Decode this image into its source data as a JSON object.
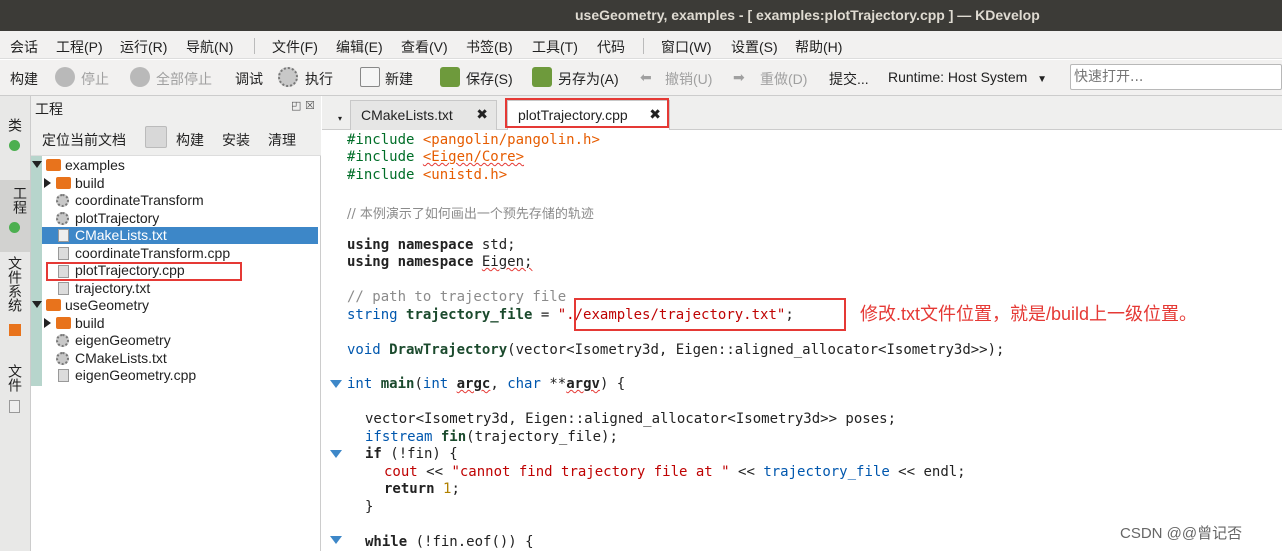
{
  "window": {
    "title": "useGeometry, examples - [ examples:plotTrajectory.cpp ] — KDevelop"
  },
  "menu": [
    "会话",
    "工程(P)",
    "运行(R)",
    "导航(N)",
    "文件(F)",
    "编辑(E)",
    "查看(V)",
    "书签(B)",
    "工具(T)",
    "代码",
    "窗口(W)",
    "设置(S)",
    "帮助(H)"
  ],
  "toolbar": {
    "build": "构建",
    "stop": "停止",
    "stop_all": "全部停止",
    "debug": "调试",
    "execute": "执行",
    "new": "新建",
    "save": "保存(S)",
    "save_as": "另存为(A)",
    "undo": "撤销(U)",
    "redo": "重做(D)",
    "commit": "提交...",
    "runtime": "Runtime: Host System",
    "quick_open_placeholder": "快速打开..."
  },
  "side_tabs": [
    "类",
    "工程",
    "文件系统",
    "文件"
  ],
  "project_panel": {
    "title": "工程",
    "actions": [
      "定位当前文档",
      "构建",
      "安装",
      "清理"
    ]
  },
  "tree": [
    {
      "label": "examples",
      "type": "folder",
      "level": 0,
      "expanded": true
    },
    {
      "label": "build",
      "type": "folder",
      "level": 1,
      "expanded": false
    },
    {
      "label": "coordinateTransform",
      "type": "target",
      "level": 1
    },
    {
      "label": "plotTrajectory",
      "type": "target",
      "level": 1
    },
    {
      "label": "CMakeLists.txt",
      "type": "file",
      "level": 1,
      "selected": true
    },
    {
      "label": "coordinateTransform.cpp",
      "type": "file",
      "level": 1
    },
    {
      "label": "plotTrajectory.cpp",
      "type": "file",
      "level": 1,
      "highlighted": true
    },
    {
      "label": "trajectory.txt",
      "type": "file",
      "level": 1
    },
    {
      "label": "useGeometry",
      "type": "folder",
      "level": 0,
      "expanded": true
    },
    {
      "label": "build",
      "type": "folder",
      "level": 1,
      "expanded": false
    },
    {
      "label": "eigenGeometry",
      "type": "target",
      "level": 1
    },
    {
      "label": "CMakeLists.txt",
      "type": "file",
      "level": 1
    },
    {
      "label": "eigenGeometry.cpp",
      "type": "file",
      "level": 1
    }
  ],
  "editor_tabs": [
    {
      "label": "CMakeLists.txt",
      "active": false
    },
    {
      "label": "plotTrajectory.cpp",
      "active": true
    }
  ],
  "code": {
    "inc1_kw": "#include",
    "inc1_path": "<pangolin/pangolin.h>",
    "inc2_kw": "#include",
    "inc2_path": "<Eigen/Core>",
    "inc3_kw": "#include",
    "inc3_path": "<unistd.h>",
    "comment1": "// 本例演示了如何画出一个预先存储的轨迹",
    "using1": "using namespace",
    "using1_ns": "std;",
    "using2": "using namespace",
    "using2_ns": "Eigen;",
    "comment2": "// path to trajectory file",
    "decl_type": "string",
    "decl_name": "trajectory_file",
    "decl_eq": " = ",
    "decl_val": "\"./examples/trajectory.txt\"",
    "decl_end": ";",
    "func_ret": "void",
    "func_name": "DrawTrajectory",
    "func_params": "(vector<Isometry3d, Eigen::aligned_allocator<Isometry3d>>);",
    "main_ret": "int",
    "main_name": "main",
    "main_params_a": "(",
    "main_int": "int",
    "main_argc": "argc",
    "main_comma": ", ",
    "main_char": "char",
    "main_stars": " **",
    "main_argv": "argv",
    "main_close": ") {",
    "l1": "vector<Isometry3d, Eigen::aligned_allocator<Isometry3d>> poses;",
    "l2_type": "ifstream",
    "l2_fn": "fin",
    "l2_rest": "(trajectory_file);",
    "l3_kw": "if",
    "l3_rest": " (!fin) {",
    "l4_cout": "cout",
    "l4_op": " << ",
    "l4_str": "\"cannot find trajectory file at \"",
    "l4_op2": " << ",
    "l4_var": "trajectory_file",
    "l4_rest": " << endl;",
    "l5_kw": "return",
    "l5_num": "1",
    "l5_end": ";",
    "l6": "}",
    "l7_kw": "while",
    "l7_rest": " (!fin.eof()) {"
  },
  "annotation": "修改.txt文件位置，就是/build上一级位置。",
  "watermark": "CSDN @@曾记否"
}
